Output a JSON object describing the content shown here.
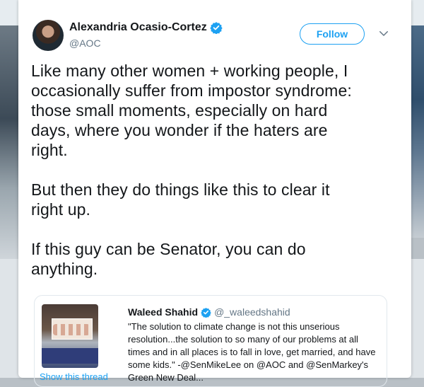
{
  "tweet": {
    "author_name": "Alexandria Ocasio-Cortez",
    "author_handle": "@AOC",
    "follow_label": "Follow",
    "paragraphs": [
      "Like many other women + working people, I\noccasionally suffer from impostor syndrome:\nthose small moments, especially on hard\ndays, where you wonder if the haters are\nright.",
      "But then they do things like this to clear it\nright up.",
      "If this guy can be Senator, you can do\nanything."
    ]
  },
  "quoted_tweet": {
    "author_name": "Waleed Shahid",
    "author_handle": "@_waleedshahid",
    "text": "\"The solution to climate change is not this unserious resolution...the solution to so many of our problems at all times and in all places is to fall in love, get married, and have some kids.\" -@SenMikeLee on @AOC and @SenMarkey's Green New Deal..."
  },
  "show_thread_label": "Show this thread",
  "colors": {
    "accent": "#1da1f2",
    "text_primary": "#14171a",
    "text_secondary": "#657786"
  },
  "icons": [
    "verified-badge-icon",
    "chevron-down-icon"
  ]
}
